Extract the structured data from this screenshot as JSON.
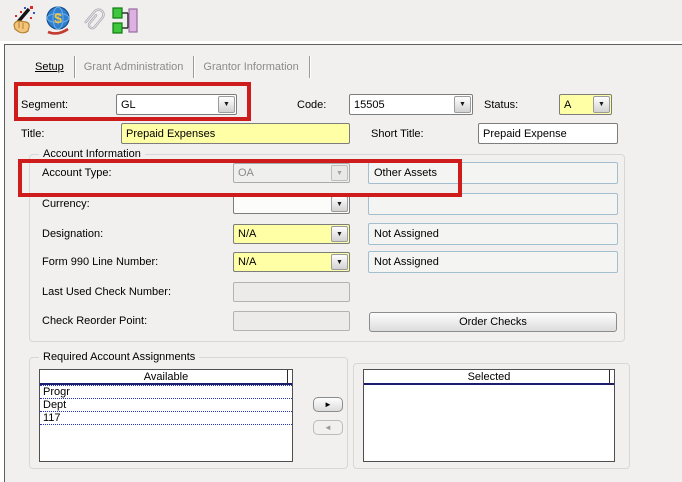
{
  "toolbar": {
    "icons": [
      "magic-wand-icon",
      "currency-globe-icon",
      "paperclip-icon",
      "account-structure-icon"
    ]
  },
  "tabs": [
    {
      "label": "Setup",
      "active": true
    },
    {
      "label": "Grant Administration",
      "active": false
    },
    {
      "label": "Grantor Information",
      "active": false
    }
  ],
  "form": {
    "segment": {
      "label": "Segment:",
      "value": "GL"
    },
    "code": {
      "label": "Code:",
      "value": "15505"
    },
    "status": {
      "label": "Status:",
      "value": "A"
    },
    "title": {
      "label": "Title:",
      "value": "Prepaid Expenses"
    },
    "short_title": {
      "label": "Short Title:",
      "value": "Prepaid Expense"
    }
  },
  "account_information": {
    "legend": "Account Information",
    "account_type": {
      "label": "Account Type:",
      "value": "OA",
      "display": "Other Assets"
    },
    "currency": {
      "label": "Currency:",
      "value": "",
      "display": ""
    },
    "designation": {
      "label": "Designation:",
      "value": "N/A",
      "display": "Not Assigned"
    },
    "form_990_line_number": {
      "label": "Form 990 Line Number:",
      "value": "N/A",
      "display": "Not Assigned"
    },
    "last_used_check_number": {
      "label": "Last Used Check Number:",
      "value": ""
    },
    "check_reorder_point": {
      "label": "Check Reorder Point:",
      "value": ""
    },
    "order_checks_button": "Order Checks"
  },
  "required_account_assignments": {
    "legend": "Required Account Assignments",
    "available": {
      "header": "Available",
      "items": [
        "Progr",
        "Dept",
        "117"
      ]
    },
    "selected": {
      "header": "Selected",
      "items": []
    },
    "move_right_glyph": "►",
    "move_left_glyph": "►"
  },
  "glyphs": {
    "combo_arrow": "▼"
  },
  "colors": {
    "highlight_yellow": "#ffffa6",
    "annotation_red": "#ce1c1c",
    "readonly_border": "#a3bdd1",
    "panel_bg": "#f1f0ee"
  }
}
